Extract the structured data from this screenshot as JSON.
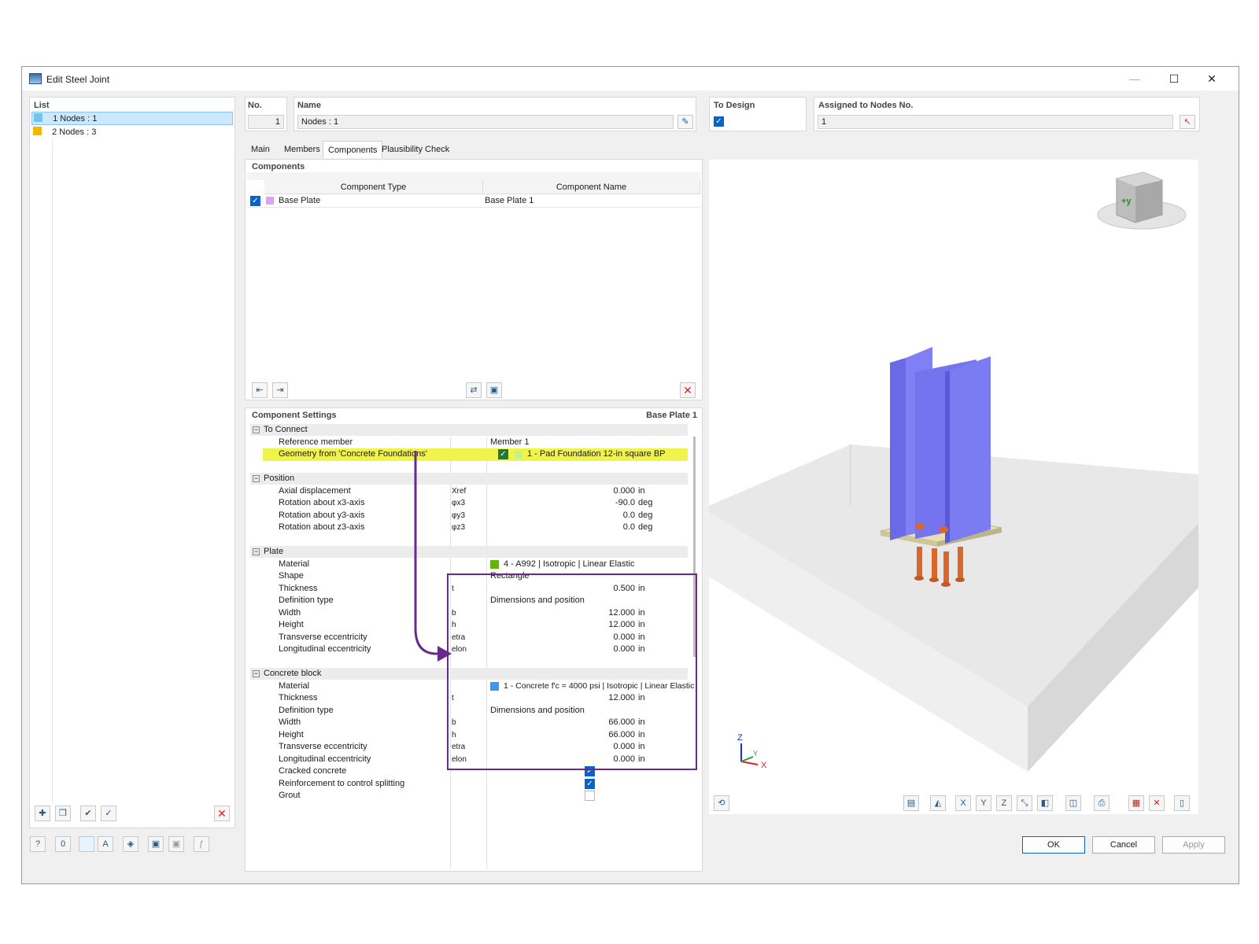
{
  "window": {
    "title": "Edit Steel Joint",
    "minimize": "—",
    "maximize": "☐",
    "close": "✕"
  },
  "list": {
    "header": "List",
    "items": [
      {
        "no": "1",
        "label": "Nodes : 1",
        "color": "#6cc6f0",
        "selected": true
      },
      {
        "no": "2",
        "label": "Nodes : 3",
        "color": "#f2b800",
        "selected": false
      }
    ]
  },
  "header": {
    "no_label": "No.",
    "no_value": "1",
    "name_label": "Name",
    "name_value": "Nodes : 1",
    "to_design_label": "To Design",
    "assigned_label": "Assigned to Nodes No.",
    "assigned_value": "1"
  },
  "tabs": [
    {
      "label": "Main"
    },
    {
      "label": "Members"
    },
    {
      "label": "Components",
      "active": true
    },
    {
      "label": "Plausibility Check"
    }
  ],
  "components": {
    "header": "Components",
    "col_type": "Component Type",
    "col_name": "Component Name",
    "rows": [
      {
        "type": "Base Plate",
        "name": "Base Plate 1",
        "color": "#d9a5f0"
      }
    ]
  },
  "settings": {
    "header": "Component Settings",
    "current": "Base Plate 1",
    "to_connect": {
      "title": "To Connect",
      "reference_member": {
        "label": "Reference member",
        "value": "Member 1"
      },
      "geometry": {
        "label": "Geometry from 'Concrete Foundations'",
        "value": "1 - Pad Foundation 12-in square BP"
      }
    },
    "position": {
      "title": "Position",
      "rows": [
        {
          "label": "Axial displacement",
          "sym": "Xref",
          "value": "0.000",
          "unit": "in"
        },
        {
          "label": "Rotation about x3-axis",
          "sym": "φx3",
          "value": "-90.0",
          "unit": "deg"
        },
        {
          "label": "Rotation about y3-axis",
          "sym": "φy3",
          "value": "0.0",
          "unit": "deg"
        },
        {
          "label": "Rotation about z3-axis",
          "sym": "φz3",
          "value": "0.0",
          "unit": "deg"
        }
      ]
    },
    "plate": {
      "title": "Plate",
      "material": {
        "label": "Material",
        "value": "4 - A992 | Isotropic | Linear Elastic",
        "color": "#5cb800"
      },
      "shape": {
        "label": "Shape",
        "value": "Rectangle"
      },
      "thickness": {
        "label": "Thickness",
        "sym": "t",
        "value": "0.500",
        "unit": "in"
      },
      "def_type": {
        "label": "Definition type",
        "value": "Dimensions and position"
      },
      "width": {
        "label": "Width",
        "sym": "b",
        "value": "12.000",
        "unit": "in"
      },
      "height": {
        "label": "Height",
        "sym": "h",
        "value": "12.000",
        "unit": "in"
      },
      "trans_ecc": {
        "label": "Transverse eccentricity",
        "sym": "etra",
        "value": "0.000",
        "unit": "in"
      },
      "long_ecc": {
        "label": "Longitudinal eccentricity",
        "sym": "elon",
        "value": "0.000",
        "unit": "in"
      }
    },
    "concrete": {
      "title": "Concrete block",
      "material": {
        "label": "Material",
        "value": "1 - Concrete f'c = 4000 psi | Isotropic | Linear Elastic",
        "color": "#3a9af0"
      },
      "thickness": {
        "label": "Thickness",
        "sym": "t",
        "value": "12.000",
        "unit": "in"
      },
      "def_type": {
        "label": "Definition type",
        "value": "Dimensions and position"
      },
      "width": {
        "label": "Width",
        "sym": "b",
        "value": "66.000",
        "unit": "in"
      },
      "height": {
        "label": "Height",
        "sym": "h",
        "value": "66.000",
        "unit": "in"
      },
      "trans_ecc": {
        "label": "Transverse eccentricity",
        "sym": "etra",
        "value": "0.000",
        "unit": "in"
      },
      "long_ecc": {
        "label": "Longitudinal eccentricity",
        "sym": "elon",
        "value": "0.000",
        "unit": "in"
      },
      "cracked": {
        "label": "Cracked concrete"
      },
      "reinforcement": {
        "label": "Reinforcement to control splitting"
      },
      "grout": {
        "label": "Grout"
      }
    }
  },
  "view": {
    "cube_label": "+y",
    "axis_z": "Z",
    "axis_x": "X",
    "axis_y": "Y",
    "colors": {
      "column": "#7b7bf2",
      "anchor": "#d9662a",
      "plate": "#e7e0b4",
      "block": "#ececec"
    }
  },
  "buttons": {
    "ok": "OK",
    "cancel": "Cancel",
    "apply": "Apply"
  }
}
